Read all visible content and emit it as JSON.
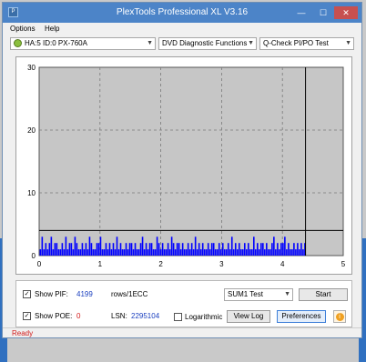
{
  "window": {
    "title": "PlexTools Professional XL V3.16",
    "app_icon": "plextools-icon",
    "controls": {
      "minimize": "—",
      "maximize": "☐",
      "close": "✕"
    }
  },
  "menu": [
    "Options",
    "Help"
  ],
  "toolbar": {
    "drive": "HA:5 ID:0  PX-760A",
    "function": "DVD Diagnostic Functions",
    "test": "Q-Check PI/PO Test"
  },
  "chart_data": {
    "type": "bar",
    "title": "",
    "xlabel": "",
    "ylabel": "",
    "xlim": [
      0,
      5
    ],
    "ylim": [
      0,
      30
    ],
    "x_ticks": [
      "0",
      "1",
      "2",
      "3",
      "4",
      "5"
    ],
    "y_ticks": [
      "0",
      "10",
      "20",
      "30"
    ],
    "grid": true,
    "threshold_line": 4,
    "data_end_x": 4.38,
    "colors": {
      "plot_bg": "#c6c6c6",
      "series": "#0000ff",
      "line": "#000000",
      "grid": "#7a7a7a"
    },
    "series": [
      {
        "name": "",
        "x": [
          0.02,
          0.05,
          0.08,
          0.11,
          0.14,
          0.17,
          0.2,
          0.23,
          0.26,
          0.29,
          0.32,
          0.35,
          0.38,
          0.41,
          0.44,
          0.47,
          0.5,
          0.53,
          0.56,
          0.59,
          0.62,
          0.65,
          0.68,
          0.71,
          0.74,
          0.77,
          0.8,
          0.83,
          0.86,
          0.89,
          0.92,
          0.95,
          0.98,
          1.01,
          1.04,
          1.07,
          1.1,
          1.13,
          1.16,
          1.19,
          1.22,
          1.25,
          1.28,
          1.31,
          1.34,
          1.37,
          1.4,
          1.43,
          1.46,
          1.49,
          1.52,
          1.55,
          1.58,
          1.61,
          1.64,
          1.67,
          1.7,
          1.73,
          1.76,
          1.79,
          1.82,
          1.85,
          1.88,
          1.91,
          1.94,
          1.97,
          2.0,
          2.03,
          2.06,
          2.09,
          2.12,
          2.15,
          2.18,
          2.21,
          2.24,
          2.27,
          2.3,
          2.33,
          2.36,
          2.39,
          2.42,
          2.45,
          2.48,
          2.51,
          2.54,
          2.57,
          2.6,
          2.63,
          2.66,
          2.69,
          2.72,
          2.75,
          2.78,
          2.81,
          2.84,
          2.87,
          2.9,
          2.93,
          2.96,
          2.99,
          3.02,
          3.05,
          3.08,
          3.11,
          3.14,
          3.17,
          3.2,
          3.23,
          3.26,
          3.29,
          3.32,
          3.35,
          3.38,
          3.41,
          3.44,
          3.47,
          3.5,
          3.53,
          3.56,
          3.59,
          3.62,
          3.65,
          3.68,
          3.71,
          3.74,
          3.77,
          3.8,
          3.83,
          3.86,
          3.89,
          3.92,
          3.95,
          3.98,
          4.01,
          4.04,
          4.07,
          4.1,
          4.13,
          4.16,
          4.19,
          4.22,
          4.25,
          4.28,
          4.31,
          4.34,
          4.37
        ],
        "values": [
          1,
          3,
          1,
          2,
          1,
          2,
          3,
          1,
          2,
          2,
          1,
          1,
          2,
          1,
          3,
          1,
          2,
          2,
          1,
          3,
          2,
          1,
          1,
          2,
          1,
          2,
          1,
          3,
          2,
          1,
          1,
          2,
          2,
          3,
          1,
          1,
          2,
          1,
          2,
          1,
          2,
          1,
          3,
          1,
          2,
          1,
          1,
          2,
          1,
          2,
          2,
          1,
          2,
          1,
          1,
          2,
          3,
          1,
          2,
          1,
          2,
          2,
          1,
          1,
          3,
          2,
          1,
          2,
          1,
          1,
          2,
          1,
          3,
          2,
          1,
          2,
          2,
          1,
          2,
          1,
          1,
          2,
          1,
          2,
          1,
          3,
          1,
          2,
          1,
          2,
          1,
          1,
          2,
          1,
          2,
          2,
          1,
          1,
          2,
          1,
          2,
          1,
          1,
          2,
          1,
          3,
          1,
          2,
          1,
          2,
          1,
          1,
          2,
          1,
          2,
          1,
          1,
          3,
          1,
          2,
          1,
          2,
          2,
          1,
          2,
          1,
          1,
          2,
          3,
          1,
          2,
          1,
          2,
          2,
          3,
          1,
          2,
          1,
          1,
          2,
          1,
          2,
          1,
          2,
          1,
          2
        ]
      }
    ]
  },
  "controls": {
    "show_pif_label": "Show PIF:",
    "show_pif_checked": "✓",
    "pif_value": "4199",
    "rows_label": "rows/1ECC",
    "show_poe_label": "Show POE:",
    "show_poe_checked": "✓",
    "poe_value": "0",
    "lsn_label": "LSN:",
    "lsn_value": "2295104",
    "logarithmic_label": "Logarithmic",
    "sum_select": "SUM1 Test",
    "start_button": "Start",
    "view_log_button": "View Log",
    "preferences_button": "Preferences",
    "info_icon": "i"
  },
  "status": "Ready"
}
